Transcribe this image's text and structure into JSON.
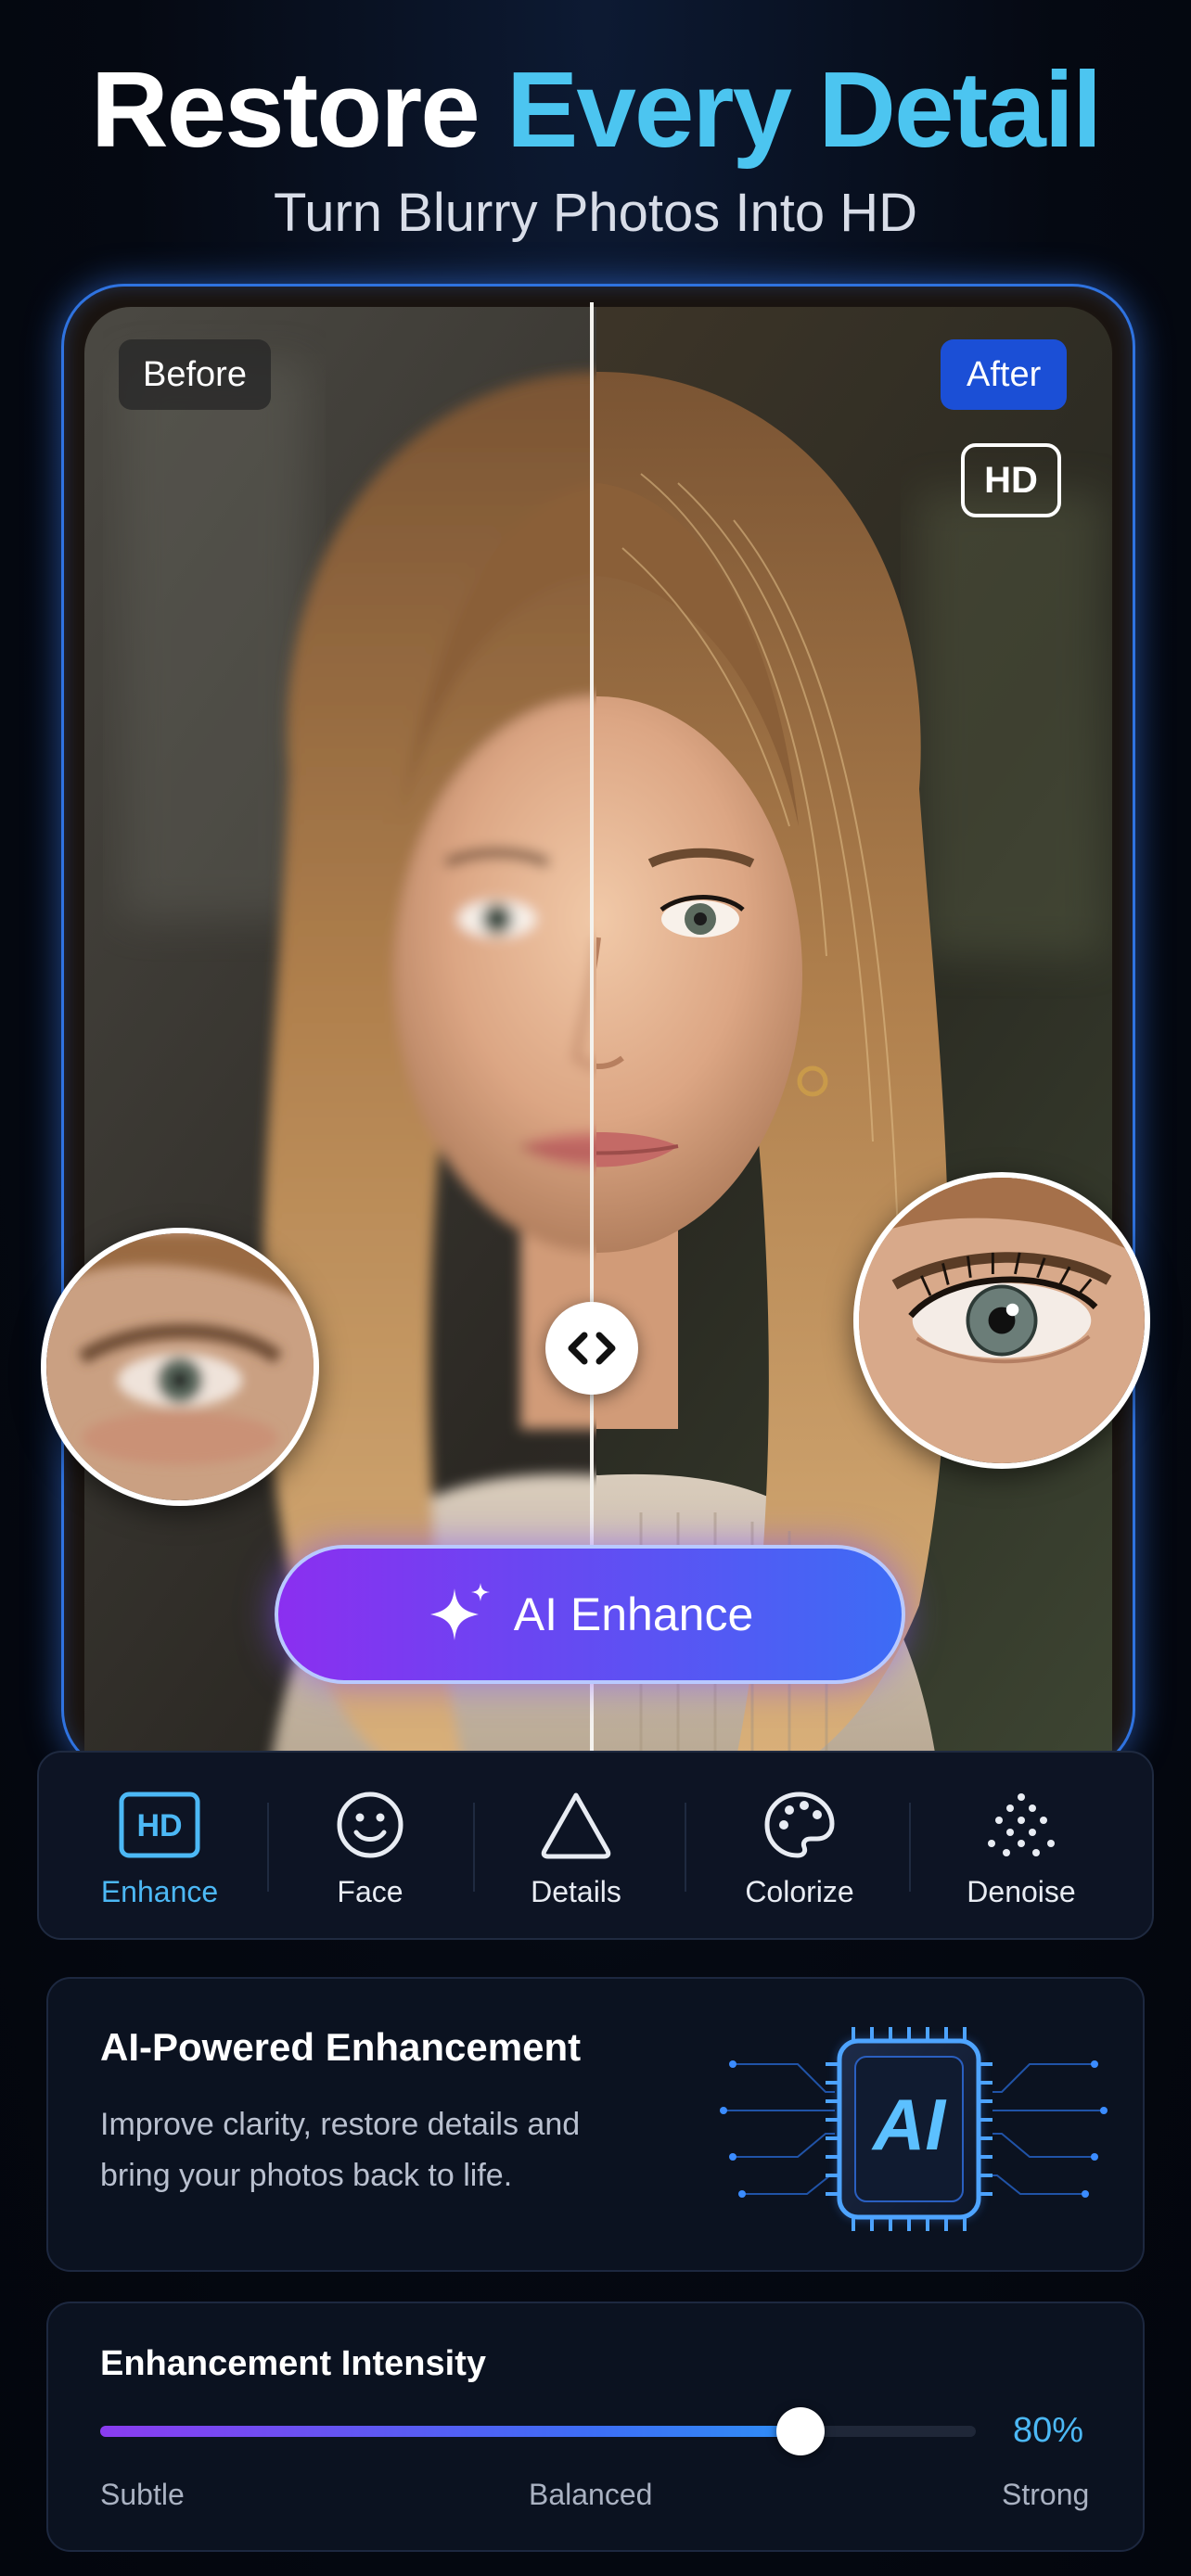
{
  "header": {
    "title_part1": "Restore ",
    "title_part2": "Every Detail",
    "subtitle": "Turn Blurry Photos Into HD"
  },
  "comparison": {
    "before_label": "Before",
    "after_label": "After",
    "hd_badge": "HD",
    "enhance_button": "AI Enhance"
  },
  "tools": [
    {
      "label": "Enhance",
      "icon": "hd-icon",
      "active": true
    },
    {
      "label": "Face",
      "icon": "smiley-face-icon",
      "active": false
    },
    {
      "label": "Details",
      "icon": "triangle-icon",
      "active": false
    },
    {
      "label": "Colorize",
      "icon": "palette-icon",
      "active": false
    },
    {
      "label": "Denoise",
      "icon": "dots-icon",
      "active": false
    }
  ],
  "tools_hd_glyph": "HD",
  "ai_card": {
    "title": "AI-Powered Enhancement",
    "description": "Improve clarity, restore details and bring your photos back to life.",
    "chip_text": "AI"
  },
  "intensity": {
    "title": "Enhancement Intensity",
    "value_label": "80%",
    "value": 0.8,
    "scale_low": "Subtle",
    "scale_mid": "Balanced",
    "scale_high": "Strong"
  },
  "colors": {
    "accent": "#4cc5f0",
    "active_tool": "#4cb8f5",
    "after_pill": "#1b4fd6",
    "background": "#050912"
  }
}
